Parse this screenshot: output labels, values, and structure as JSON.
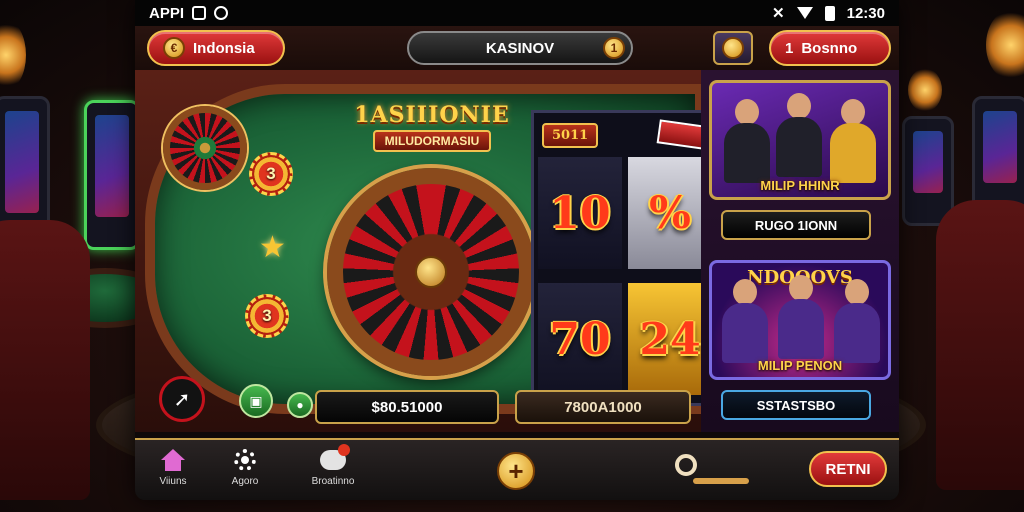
{
  "status_bar": {
    "app_label": "APPI",
    "time": "12:30"
  },
  "top_bar": {
    "region_label": "Indonsia",
    "region_coin": "€",
    "title": "KASINOV",
    "title_coin": "1",
    "settings_icon": "coin-badge-icon",
    "promo_label": "Bosnno",
    "promo_coin": "1"
  },
  "game": {
    "logo_title": "1ASIIIONIE",
    "logo_subtitle": "MILUDORMASIU",
    "chips": [
      "3",
      "3"
    ],
    "reel_badge": "5011",
    "reels": [
      {
        "value": "10",
        "style": "dark"
      },
      {
        "value": "%",
        "style": "light"
      },
      {
        "value": "70",
        "style": "dark"
      },
      {
        "value": "24",
        "style": "gold"
      }
    ],
    "bet_1": "$80.51000",
    "bet_2": "7800A1000"
  },
  "promo": {
    "card_1_caption": "MILIP HHINR",
    "button_1": "RUGO 1IONN",
    "card_2_title": "NDOOOVS",
    "card_2_caption": "MILIP PENON",
    "button_2": "SSTASTSBO"
  },
  "nav": {
    "items": [
      {
        "label": "Viiuns",
        "icon": "home-icon"
      },
      {
        "label": "Agoro",
        "icon": "gear-icon"
      },
      {
        "label": "Broatinno",
        "icon": "chat-icon"
      }
    ],
    "plus_label": "+",
    "return_label": "RETNI"
  },
  "colors": {
    "accent_gold": "#f2c14e",
    "accent_red": "#c4121c",
    "felt_green": "#1a6136"
  }
}
